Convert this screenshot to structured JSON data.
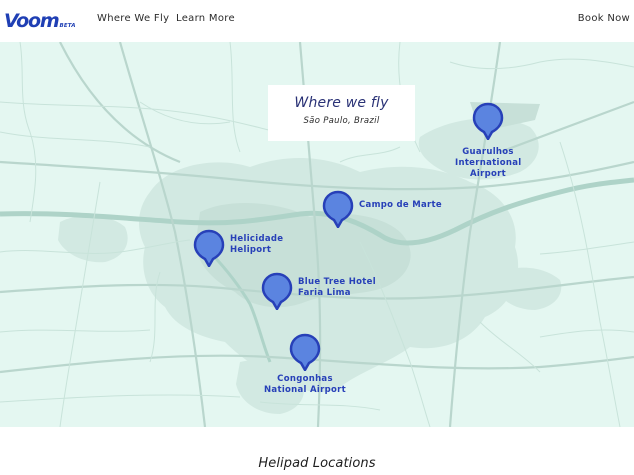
{
  "header": {
    "logo_text": "Voom",
    "logo_badge": "BETA",
    "nav": [
      {
        "label": "Where We Fly"
      },
      {
        "label": "Learn More"
      }
    ],
    "book_label": "Book Now"
  },
  "map": {
    "title": "Where we fly",
    "subtitle": "São Paulo, Brazil",
    "locations": [
      {
        "lines": [
          "Guarulhos",
          "International",
          "Airport"
        ]
      },
      {
        "lines": [
          "Campo de Marte"
        ]
      },
      {
        "lines": [
          "Helicidade",
          "Heliport"
        ]
      },
      {
        "lines": [
          "Blue Tree Hotel",
          "Faria Lima"
        ]
      },
      {
        "lines": [
          "Congonhas",
          "National Airport"
        ]
      }
    ]
  },
  "section": {
    "title": "Helipad Locations"
  },
  "colors": {
    "brand": "#1f3fb4",
    "pin_fill": "#5b84e0",
    "pin_border": "#2740b8",
    "map_bg": "#e4f7f1",
    "urban": "#cfe6df"
  }
}
